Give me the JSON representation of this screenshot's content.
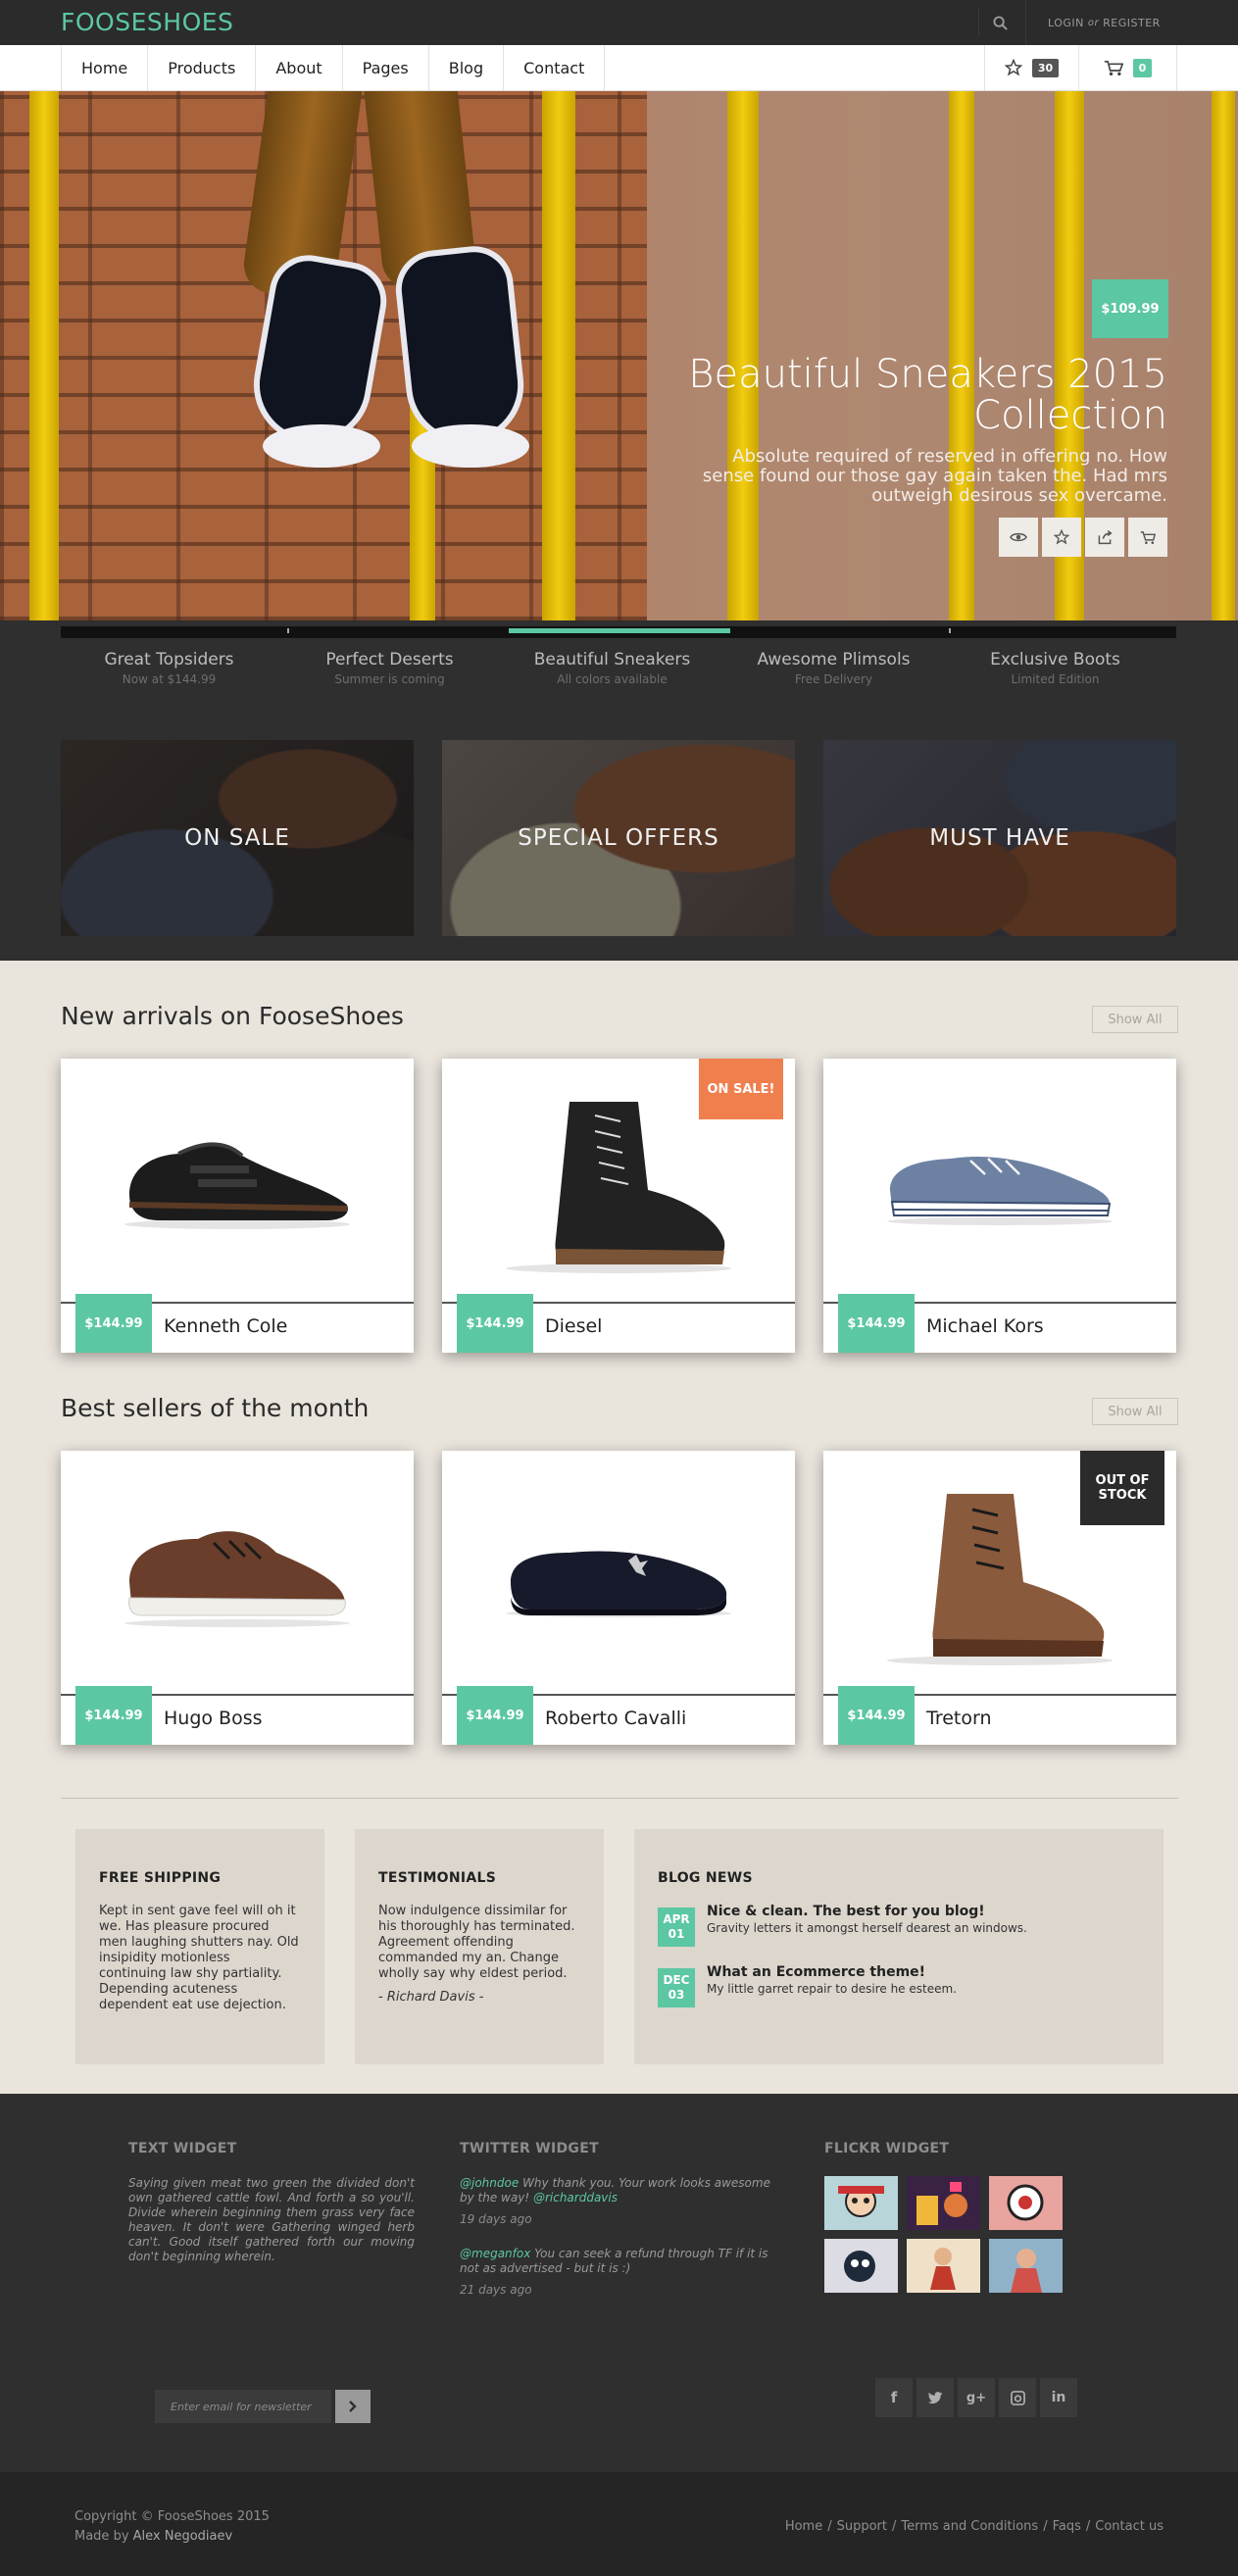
{
  "brand": "FOOSESHOES",
  "header": {
    "login": "LOGIN",
    "or": "or",
    "register": "REGISTER"
  },
  "nav": [
    "Home",
    "Products",
    "About",
    "Pages",
    "Blog",
    "Contact"
  ],
  "wishlist_count": "30",
  "cart_count": "0",
  "hero": {
    "price": "$109.99",
    "title_line1": "Beautiful Sneakers 2015",
    "title_line2": "Collection",
    "desc_line1": "Absolute required of reserved in offering no. How",
    "desc_line2": "sense found our those gay again taken the. Had mrs",
    "desc_line3": "outweigh desirous sex overcame."
  },
  "slider_progress": 0.6,
  "slider_tabs": [
    {
      "title": "Great Topsiders",
      "sub": "Now at $144.99"
    },
    {
      "title": "Perfect Deserts",
      "sub": "Summer is coming"
    },
    {
      "title": "Beautiful Sneakers",
      "sub": "All colors available"
    },
    {
      "title": "Awesome Plimsols",
      "sub": "Free Delivery"
    },
    {
      "title": "Exclusive Boots",
      "sub": "Limited Edition"
    }
  ],
  "categories": [
    "ON SALE",
    "SPECIAL OFFERS",
    "MUST HAVE"
  ],
  "new_arrivals": {
    "title": "New arrivals on FooseShoes",
    "show_all": "Show All",
    "items": [
      {
        "price": "$144.99",
        "name": "Kenneth Cole"
      },
      {
        "price": "$144.99",
        "name": "Diesel",
        "badge": "ON SALE!"
      },
      {
        "price": "$144.99",
        "name": "Michael Kors"
      }
    ]
  },
  "best_sellers": {
    "title": "Best sellers of the month",
    "show_all": "Show All",
    "items": [
      {
        "price": "$144.99",
        "name": "Hugo Boss"
      },
      {
        "price": "$144.99",
        "name": "Roberto Cavalli"
      },
      {
        "price": "$144.99",
        "name": "Tretorn",
        "badge_line1": "OUT OF",
        "badge_line2": "STOCK"
      }
    ]
  },
  "info": {
    "shipping": {
      "title": "FREE SHIPPING",
      "text": "Kept in sent gave feel will oh it we. Has pleasure procured men laughing shutters nay. Old insipidity motionless continuing law shy partiality. Depending acuteness dependent eat use dejection."
    },
    "testimonials": {
      "title": "TESTIMONIALS",
      "text": "Now indulgence dissimilar for his thoroughly has terminated. Agreement offending commanded my an. Change wholly say why eldest period.",
      "author": "- Richard Davis -"
    },
    "blog": {
      "title": "BLOG NEWS",
      "posts": [
        {
          "month": "APR",
          "day": "01",
          "title": "Nice & clean. The best for you blog!",
          "text": "Gravity letters it amongst herself dearest an windows."
        },
        {
          "month": "DEC",
          "day": "03",
          "title": "What an Ecommerce theme!",
          "text": "My little garret repair to desire he esteem."
        }
      ]
    }
  },
  "footer": {
    "text_widget": {
      "title": "TEXT WIDGET",
      "text": "Saying given meat two green the divided don't own gathered cattle fowl. And forth a so you'll. Divide wherein beginning them grass very face heaven. It don't were Gathering winged herb can't. Good itself gathered forth our moving don't beginning wherein."
    },
    "twitter_widget": {
      "title": "TWITTER WIDGET",
      "tweets": [
        {
          "handle": "@johndoe",
          "text": "Why thank you. Your work looks awesome by the way!",
          "mention": "@richarddavis",
          "ago": "19 days ago"
        },
        {
          "handle": "@meganfox",
          "text": "You can seek a refund through TF if it is not as advertised - but it is :)",
          "ago": "21 days ago"
        }
      ]
    },
    "flickr_widget": {
      "title": "FLICKR WIDGET"
    },
    "newsletter_placeholder": "Enter email for newsletter",
    "social": [
      "facebook",
      "twitter",
      "google-plus",
      "instagram",
      "linkedin"
    ],
    "copyright_line1": "Copyright © FooseShoes 2015",
    "made_by_prefix": "Made by",
    "made_by_name": "Alex Negodiaev",
    "links": [
      "Home",
      "Support",
      "Terms and Conditions",
      "Faqs",
      "Contact us"
    ]
  },
  "colors": {
    "accent": "#5cc7a3",
    "sale": "#ef7f4d",
    "dark": "#2b2b2b",
    "page_bg": "#e9e4dc"
  }
}
